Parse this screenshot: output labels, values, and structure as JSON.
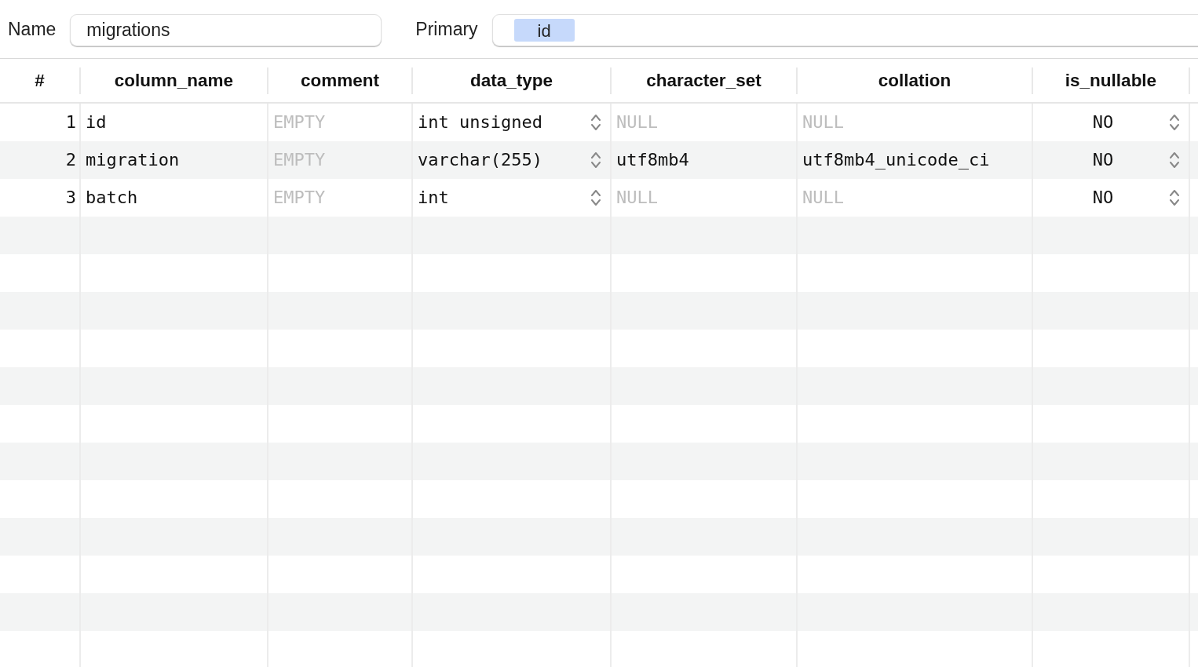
{
  "form": {
    "name_label": "Name",
    "name_value": "migrations",
    "primary_label": "Primary",
    "primary_keys": [
      "id"
    ]
  },
  "table": {
    "columns": [
      {
        "label": "#",
        "kind": "number"
      },
      {
        "label": "column_name",
        "kind": "text"
      },
      {
        "label": "comment",
        "kind": "text"
      },
      {
        "label": "data_type",
        "kind": "select"
      },
      {
        "label": "character_set",
        "kind": "text"
      },
      {
        "label": "collation",
        "kind": "text"
      },
      {
        "label": "is_nullable",
        "kind": "select_center"
      }
    ],
    "rows": [
      {
        "selected": false,
        "cells": [
          {
            "text": "1",
            "muted": false
          },
          {
            "text": "id",
            "muted": false
          },
          {
            "text": "EMPTY",
            "muted": true
          },
          {
            "text": "int unsigned",
            "muted": false
          },
          {
            "text": "NULL",
            "muted": true
          },
          {
            "text": "NULL",
            "muted": true
          },
          {
            "text": "NO",
            "muted": false
          }
        ]
      },
      {
        "selected": false,
        "cells": [
          {
            "text": "2",
            "muted": false
          },
          {
            "text": "migration",
            "muted": false
          },
          {
            "text": "EMPTY",
            "muted": true
          },
          {
            "text": "varchar(255)",
            "muted": false
          },
          {
            "text": "utf8mb4",
            "muted": false
          },
          {
            "text": "utf8mb4_unicode_ci",
            "muted": false
          },
          {
            "text": "NO",
            "muted": false
          }
        ]
      },
      {
        "selected": false,
        "cells": [
          {
            "text": "3",
            "muted": false
          },
          {
            "text": "batch",
            "muted": false
          },
          {
            "text": "EMPTY",
            "muted": true
          },
          {
            "text": "int",
            "muted": false
          },
          {
            "text": "NULL",
            "muted": true
          },
          {
            "text": "NULL",
            "muted": true
          },
          {
            "text": "NO",
            "muted": false
          }
        ]
      }
    ]
  }
}
